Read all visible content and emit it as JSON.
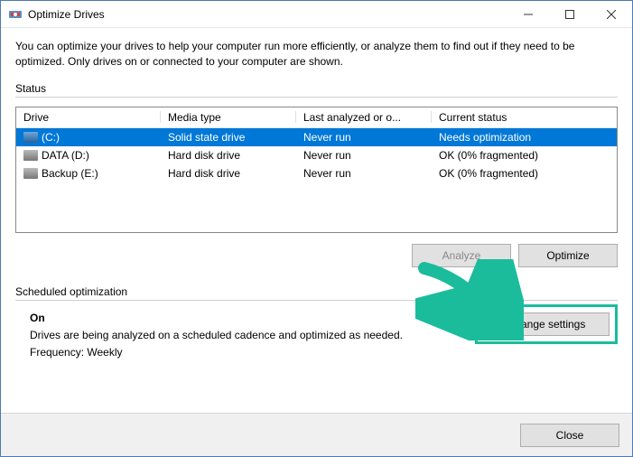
{
  "window": {
    "title": "Optimize Drives"
  },
  "intro": "You can optimize your drives to help your computer run more efficiently, or analyze them to find out if they need to be optimized. Only drives on or connected to your computer are shown.",
  "status_label": "Status",
  "table": {
    "headers": {
      "drive": "Drive",
      "media": "Media type",
      "last": "Last analyzed or o...",
      "status": "Current status"
    },
    "rows": [
      {
        "name": "(C:)",
        "media": "Solid state drive",
        "last": "Never run",
        "status": "Needs optimization",
        "icon": "ssd",
        "selected": true
      },
      {
        "name": "DATA (D:)",
        "media": "Hard disk drive",
        "last": "Never run",
        "status": "OK (0% fragmented)",
        "icon": "hdd",
        "selected": false
      },
      {
        "name": "Backup (E:)",
        "media": "Hard disk drive",
        "last": "Never run",
        "status": "OK (0% fragmented)",
        "icon": "hdd",
        "selected": false
      }
    ]
  },
  "buttons": {
    "analyze": "Analyze",
    "optimize": "Optimize",
    "change_settings": "Change settings",
    "close": "Close"
  },
  "sched": {
    "label": "Scheduled optimization",
    "status": "On",
    "desc": "Drives are being analyzed on a scheduled cadence and optimized as needed.",
    "freq": "Frequency: Weekly"
  }
}
